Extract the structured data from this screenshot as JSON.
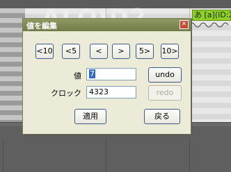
{
  "background": {
    "watermark": "ALOID2",
    "note_label": "あ [a](ID:2"
  },
  "dialog": {
    "title": "値を編集",
    "close_icon": "close-icon",
    "step_buttons": [
      "<10",
      "<5",
      "<",
      ">",
      "5>",
      "10>"
    ],
    "value_label": "値",
    "value": "7",
    "clock_label": "クロック",
    "clock": "4323",
    "undo_label": "undo",
    "redo_label": "redo",
    "apply_label": "適用",
    "back_label": "戻る"
  },
  "colors": {
    "titlebar": "#7f8a55",
    "dialog_bg": "#ecebd8",
    "note_fill": "#8ecf2a",
    "button_border": "#3d5a86",
    "selection": "#316ac5"
  }
}
